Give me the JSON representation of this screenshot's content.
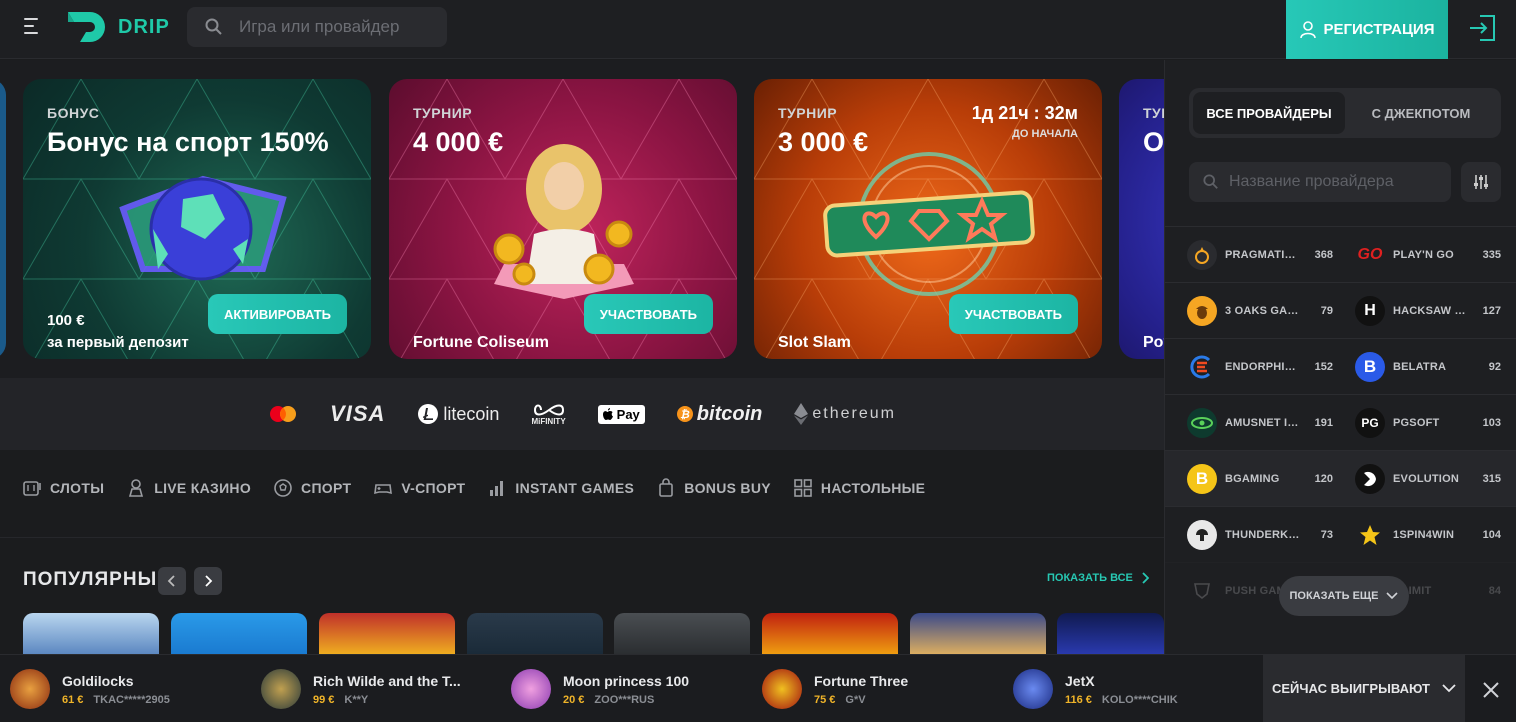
{
  "header": {
    "logo_text": "DRIP",
    "search_placeholder": "Игра или провайдер",
    "register_label": "РЕГИСТРАЦИЯ"
  },
  "banners": [
    {
      "tag": "БОНУС",
      "title": "Бонус на спорт 150%",
      "sub1": "100 €",
      "sub2": "за первый депозит",
      "cta": "АКТИВИРОВАТЬ"
    },
    {
      "tag": "ТУРНИР",
      "title": "4 000 €",
      "game": "Fortune Coliseum",
      "cta": "УЧАСТВОВАТЬ"
    },
    {
      "tag": "ТУРНИР",
      "title": "3 000 €",
      "game": "Slot Slam",
      "cta": "УЧАСТВОВАТЬ",
      "timer": "1д 21ч : 32м",
      "timer_label": "ДО НАЧАЛА"
    },
    {
      "tag": "ТУР",
      "title": "О",
      "game": "Pov"
    }
  ],
  "payments": [
    "litecoin",
    "MiFINITY",
    "Pay",
    "bitcoin",
    "ethereum"
  ],
  "payments_visa": "VISA",
  "categories": [
    "СЛОТЫ",
    "LIVE КАЗИНО",
    "СПОРТ",
    "V-СПОРТ",
    "INSTANT GAMES",
    "BONUS BUY",
    "НАСТОЛЬНЫЕ"
  ],
  "popular": {
    "title": "ПОПУЛЯРНЫЕ",
    "show_all": "ПОКАЗАТЬ ВСЕ"
  },
  "sidebar": {
    "tabs": [
      "ВСЕ ПРОВАЙДЕРЫ",
      "С ДЖЕКПОТОМ"
    ],
    "search_placeholder": "Название провайдера",
    "providers": [
      [
        {
          "name": "PRAGMATIC ...",
          "count": "368"
        },
        {
          "name": "PLAY'N GO",
          "count": "335"
        }
      ],
      [
        {
          "name": "3 OAKS GAM...",
          "count": "79"
        },
        {
          "name": "HACKSAW GA...",
          "count": "127"
        }
      ],
      [
        {
          "name": "ENDORPHINA",
          "count": "152"
        },
        {
          "name": "BELATRA",
          "count": "92"
        }
      ],
      [
        {
          "name": "AMUSNET IN...",
          "count": "191"
        },
        {
          "name": "PGSOFT",
          "count": "103"
        }
      ],
      [
        {
          "name": "BGAMING",
          "count": "120"
        },
        {
          "name": "EVOLUTION",
          "count": "315"
        }
      ],
      [
        {
          "name": "THUNDERKICK",
          "count": "73"
        },
        {
          "name": "1SPIN4WIN",
          "count": "104"
        }
      ],
      [
        {
          "name": "PUSH GAM",
          "count": ""
        },
        {
          "name": "OLIMIT",
          "count": "84"
        }
      ]
    ],
    "show_more": "ПОКАЗАТЬ ЕЩЕ",
    "provider_icon_text": {
      "playngo": "GO",
      "belatra": "B",
      "pgsoft": "PG",
      "bgaming": "B",
      "hacksaw": "H"
    }
  },
  "winners": [
    {
      "game": "Goldilocks",
      "amount": "61 €",
      "user": "TKAC*****2905"
    },
    {
      "game": "Rich Wilde and the T...",
      "amount": "99 €",
      "user": "K**Y"
    },
    {
      "game": "Moon princess 100",
      "amount": "20 €",
      "user": "ZOO***RUS"
    },
    {
      "game": "Fortune Three",
      "amount": "75 €",
      "user": "G*V"
    },
    {
      "game": "JetX",
      "amount": "116 €",
      "user": "KOLO****CHIK"
    }
  ],
  "now_winning": "СЕЙЧАС ВЫИГРЫВАЮТ",
  "colors": {
    "accent": "#27c8b3",
    "amount": "#f0b429"
  }
}
